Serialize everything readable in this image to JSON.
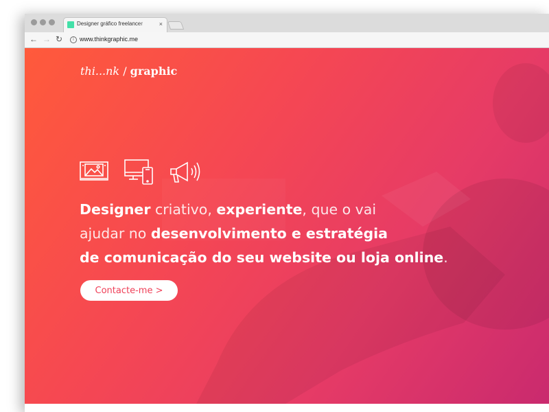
{
  "browser": {
    "tab": {
      "title": "Designer gráfico freelancer",
      "close_glyph": "×",
      "favicon_color": "#43e0a8"
    },
    "toolbar": {
      "back_glyph": "←",
      "forward_glyph": "→",
      "reload_glyph": "↻",
      "info_glyph": "i",
      "url": "www.thinkgraphic.me"
    }
  },
  "hero": {
    "logo": {
      "prefix": "thi...nk",
      "separator": " / ",
      "suffix": "graphic"
    },
    "icons": [
      "image-gallery-icon",
      "responsive-devices-icon",
      "megaphone-icon"
    ],
    "headline": {
      "line1": {
        "p1": "Designer",
        "p2": " criativo, ",
        "p3": "experiente",
        "p4": ", que o vai"
      },
      "line2": {
        "p1": "ajudar no ",
        "p2": "desenvolvimento e estratégia"
      },
      "line3": {
        "p1": "de comunicação do seu website ou loja online",
        "p2": "."
      }
    },
    "cta_label": "Contacte-me  >"
  },
  "colors": {
    "gradient_start": "#ff5a3b",
    "gradient_end": "#c92a6e",
    "cta_text": "#ef3f57",
    "text": "#ffffff"
  }
}
